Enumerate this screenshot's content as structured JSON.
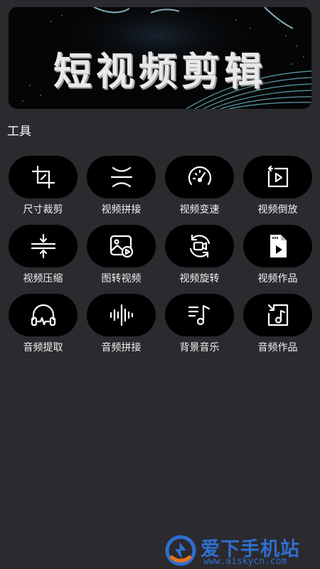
{
  "banner": {
    "title": "短视频剪辑"
  },
  "section": {
    "title": "工具"
  },
  "tools": [
    {
      "label": "尺寸裁剪",
      "icon": "crop-icon"
    },
    {
      "label": "视频拼接",
      "icon": "merge-icon"
    },
    {
      "label": "视频变速",
      "icon": "speedometer-icon"
    },
    {
      "label": "视频倒放",
      "icon": "reverse-play-icon"
    },
    {
      "label": "视频压缩",
      "icon": "compress-icon"
    },
    {
      "label": "图转视频",
      "icon": "image-to-video-icon"
    },
    {
      "label": "视频旋转",
      "icon": "rotate-video-icon"
    },
    {
      "label": "视频作品",
      "icon": "video-file-icon"
    },
    {
      "label": "音频提取",
      "icon": "headphones-icon"
    },
    {
      "label": "音频拼接",
      "icon": "waveform-icon"
    },
    {
      "label": "背景音乐",
      "icon": "music-list-icon"
    },
    {
      "label": "音频作品",
      "icon": "music-file-icon"
    }
  ],
  "watermark": {
    "text": "爱下手机站",
    "url": "www.aiskycn.com"
  },
  "colors": {
    "background": "#2b2a2e",
    "button": "#000000",
    "watermark": "#2f6fd0"
  }
}
